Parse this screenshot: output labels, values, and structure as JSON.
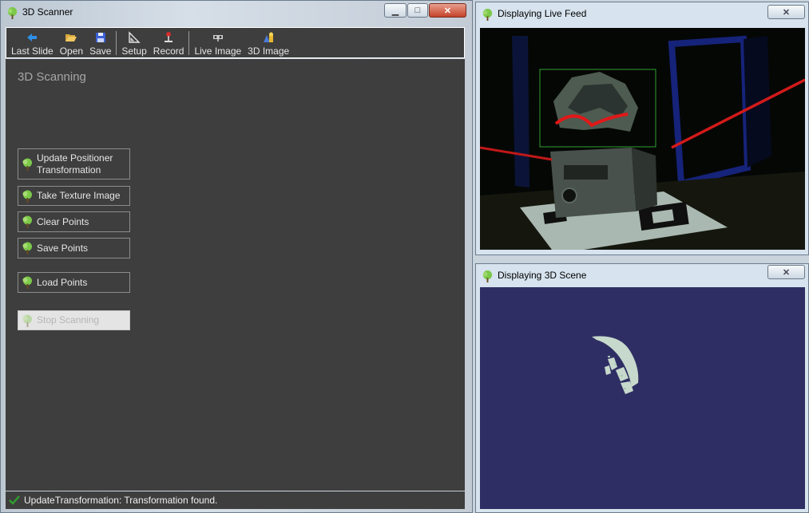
{
  "main_window": {
    "title": "3D Scanner",
    "controls": {
      "minimize": "▁",
      "maximize": "□",
      "close": "✕"
    }
  },
  "toolbar": {
    "items": [
      {
        "label": "Last Slide",
        "icon": "back-arrow-icon"
      },
      {
        "label": "Open",
        "icon": "folder-open-icon"
      },
      {
        "label": "Save",
        "icon": "floppy-disk-icon"
      },
      {
        "label": "Setup",
        "icon": "set-square-icon"
      },
      {
        "label": "Record",
        "icon": "record-stand-icon"
      },
      {
        "label": "Live Image",
        "icon": "camera-rig-icon"
      },
      {
        "label": "3D Image",
        "icon": "3d-shapes-icon"
      }
    ]
  },
  "panel": {
    "title": "3D Scanning",
    "buttons": [
      {
        "label_line1": "Update Positioner",
        "label_line2": "Transformation",
        "enabled": true
      },
      {
        "label": "Take Texture Image",
        "enabled": true
      },
      {
        "label": "Clear Points",
        "enabled": true
      },
      {
        "label": "Save Points",
        "enabled": true
      },
      {
        "label": "Load Points",
        "enabled": true
      },
      {
        "label": "Stop Scanning",
        "enabled": false
      }
    ]
  },
  "status": {
    "text": "UpdateTransformation: Transformation found.",
    "icon": "check-icon",
    "color": "#2ea02e"
  },
  "live_feed_window": {
    "title": "Displaying Live Feed",
    "close": "✕"
  },
  "scene_window": {
    "title": "Displaying 3D Scene",
    "close": "✕",
    "background": "#2f2e64"
  },
  "colors": {
    "panel_bg": "#3e3e3e",
    "app_icon": "#6bbf3a",
    "laser": "#e01818",
    "roi_box": "#2fa02f",
    "marker_frame": "#1a2a8a"
  }
}
